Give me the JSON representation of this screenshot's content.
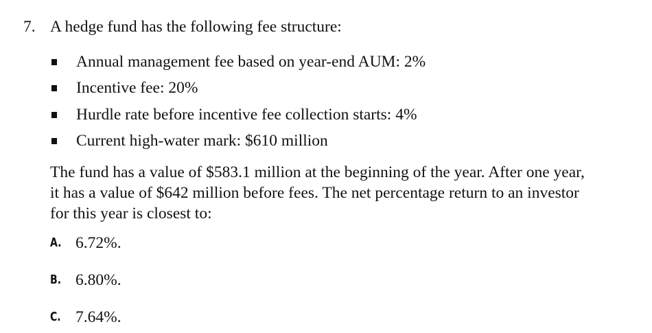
{
  "question": {
    "number": "7.",
    "stem": "A hedge fund has the following fee structure:",
    "bullets": [
      "Annual management fee based on year-end AUM: 2%",
      "Incentive fee: 20%",
      "Hurdle rate before incentive fee collection starts: 4%",
      "Current high-water mark: $610 million"
    ],
    "paragraph_lines": [
      "The fund has a value of $583.1 million at the beginning of the year. After one year,",
      "it has a value of $642 million before fees. The net percentage return to an investor",
      "for this year is closest to:"
    ],
    "choices": [
      {
        "letter": "A.",
        "text": "6.72%."
      },
      {
        "letter": "B.",
        "text": "6.80%."
      },
      {
        "letter": "C.",
        "text": "7.64%."
      }
    ]
  }
}
